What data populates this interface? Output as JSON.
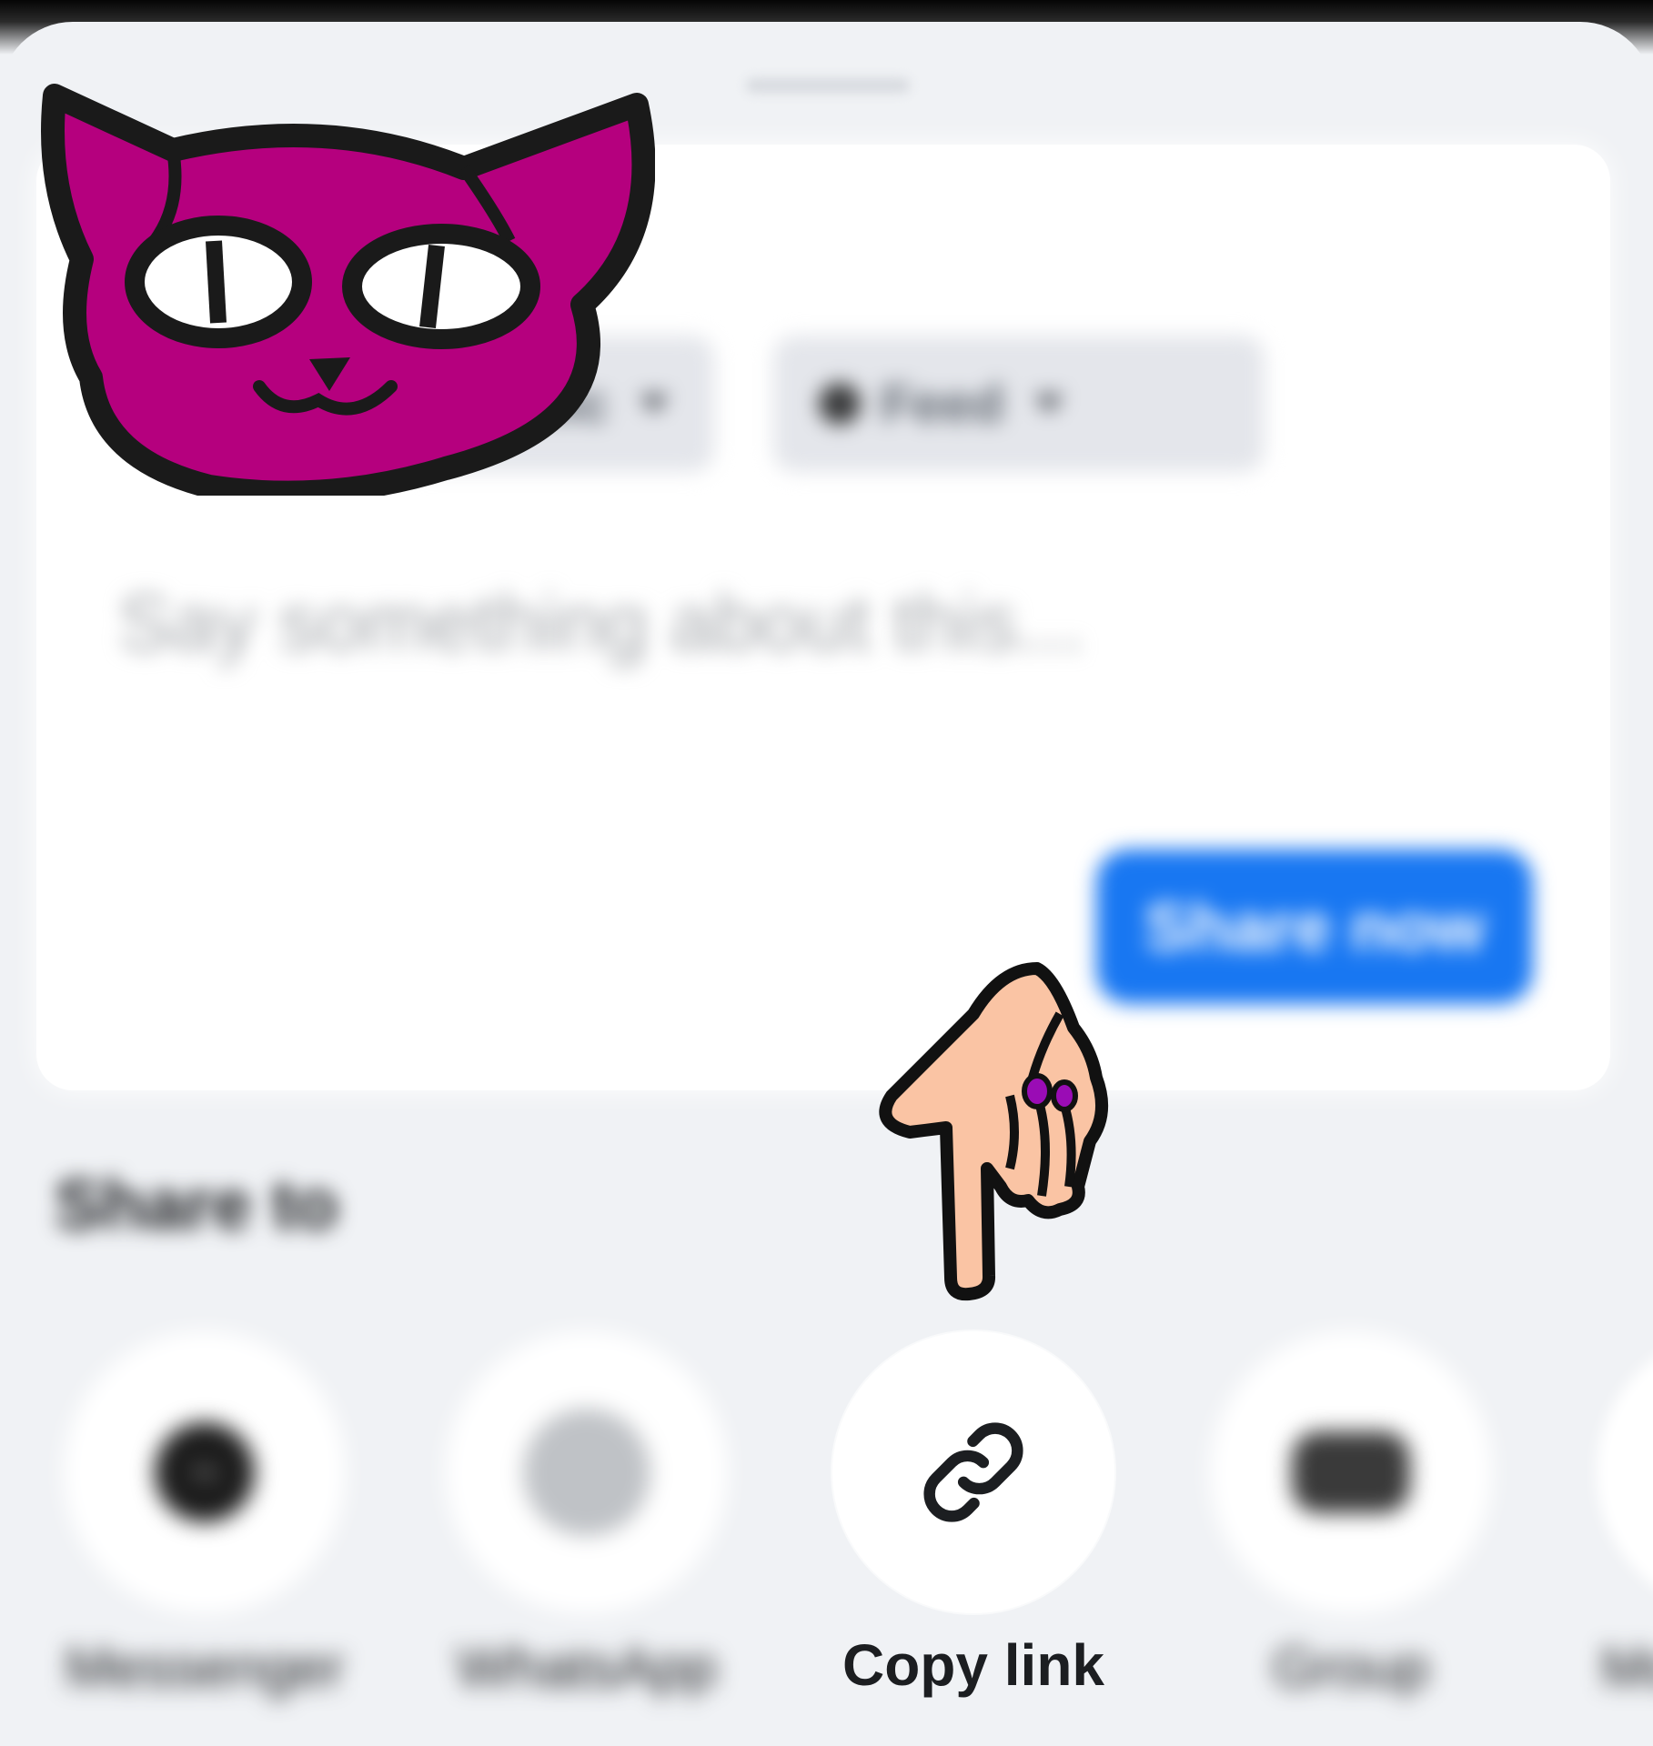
{
  "sheet": {
    "audience_chip_label": "Public",
    "feed_chip_label": "Feed"
  },
  "composer": {
    "placeholder": "Say something about this...",
    "share_now_label": "Share now"
  },
  "share_to": {
    "heading": "Share to",
    "targets": [
      {
        "label": "Messenger",
        "icon": "messenger-icon"
      },
      {
        "label": "WhatsApp",
        "icon": "whatsapp-icon"
      },
      {
        "label": "Copy link",
        "icon": "link-icon"
      },
      {
        "label": "Group",
        "icon": "group-icon"
      },
      {
        "label": "More",
        "icon": "more-icon"
      }
    ]
  },
  "colors": {
    "sheet_background": "#f0f2f5",
    "composer_background": "#ffffff",
    "share_now_button": "#1877f2",
    "cat_sticker": "#b5007e",
    "hand_sticker": "#fac4a4",
    "hand_nail": "#9a0cb5"
  },
  "stickers": [
    "magenta-cat-face",
    "pointing-hand"
  ]
}
